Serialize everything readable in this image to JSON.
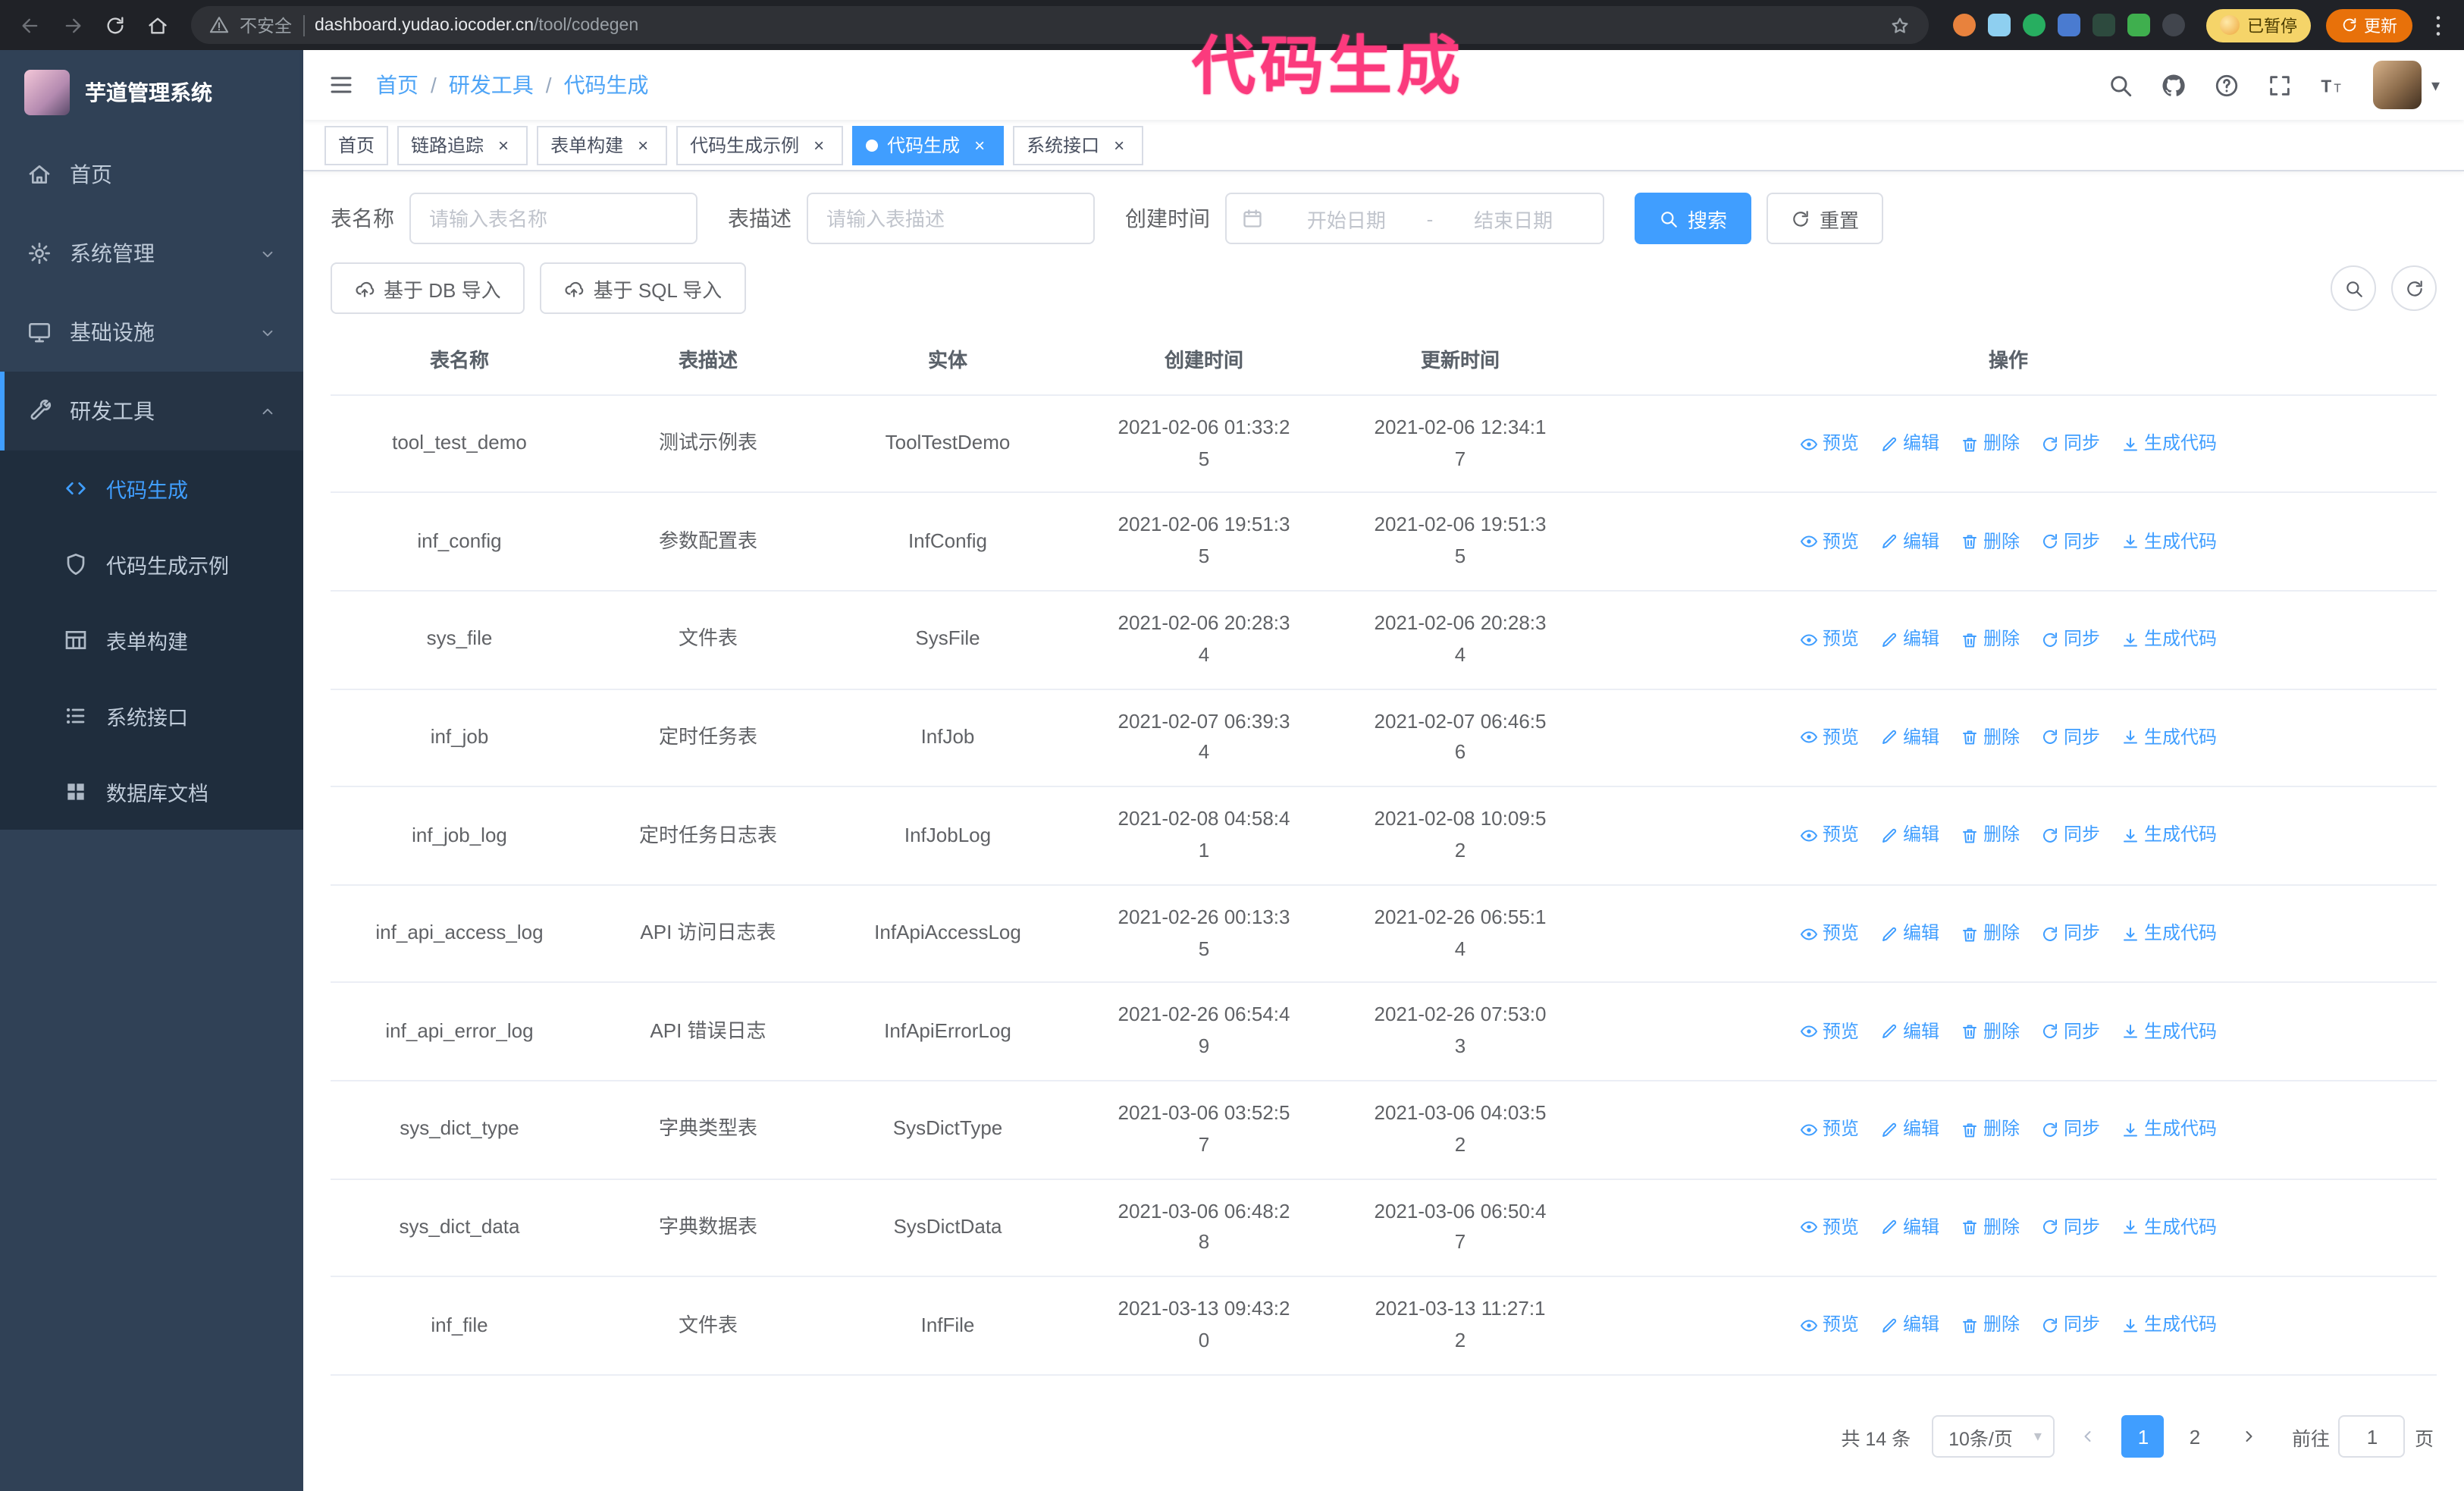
{
  "colors": {
    "primary": "#409EFF",
    "sidebar": "#304156",
    "submenu": "#1f2d3d",
    "annotation": "#fb3a7d"
  },
  "browser": {
    "address": {
      "security_label": "不安全",
      "host": "dashboard.yudao.iocoder.cn",
      "path": "/tool/codegen"
    },
    "paused_badge": "已暂停",
    "update_button": "更新",
    "extensions": [
      {
        "name": "extension-fox-icon",
        "color": "#e8823d",
        "shape": "circle"
      },
      {
        "name": "extension-drop-icon",
        "color": "#8ecff0",
        "shape": "square"
      },
      {
        "name": "extension-check-icon",
        "color": "#27ae60",
        "shape": "circle"
      },
      {
        "name": "extension-users-icon",
        "color": "#4a7bd0",
        "shape": "square"
      },
      {
        "name": "extension-chart-icon",
        "color": "#2d4a3e",
        "shape": "square"
      },
      {
        "name": "extension-leaf-icon",
        "color": "#3faf4e",
        "shape": "square"
      },
      {
        "name": "extension-pin-icon",
        "color": "#41454d",
        "shape": "circle"
      }
    ]
  },
  "annotation": {
    "text": "代码生成"
  },
  "sidebar": {
    "logo_title": "芋道管理系统",
    "items": [
      {
        "key": "home",
        "label": "首页",
        "icon": "home-icon"
      },
      {
        "key": "system",
        "label": "系统管理",
        "icon": "gear-icon",
        "chevron": "down"
      },
      {
        "key": "infra",
        "label": "基础设施",
        "icon": "monitor-icon",
        "chevron": "down"
      },
      {
        "key": "devtools",
        "label": "研发工具",
        "icon": "wrench-icon",
        "chevron": "up",
        "active": true,
        "children": [
          {
            "key": "codegen",
            "label": "代码生成",
            "icon": "code-icon",
            "active": true
          },
          {
            "key": "codegen-demo",
            "label": "代码生成示例",
            "icon": "shield-icon"
          },
          {
            "key": "form-builder",
            "label": "表单构建",
            "icon": "form-icon"
          },
          {
            "key": "system-api",
            "label": "系统接口",
            "icon": "list-icon"
          },
          {
            "key": "db-doc",
            "label": "数据库文档",
            "icon": "grid-icon"
          }
        ]
      }
    ]
  },
  "navbar": {
    "breadcrumb": [
      "首页",
      "研发工具",
      "代码生成"
    ],
    "breadcrumb_separator": "/"
  },
  "tabs": [
    {
      "key": "home",
      "label": "首页",
      "closable": false,
      "active": false
    },
    {
      "key": "tracer",
      "label": "链路追踪",
      "closable": true,
      "active": false
    },
    {
      "key": "form-builder",
      "label": "表单构建",
      "closable": true,
      "active": false
    },
    {
      "key": "codegen-demo",
      "label": "代码生成示例",
      "closable": true,
      "active": false
    },
    {
      "key": "codegen",
      "label": "代码生成",
      "closable": true,
      "active": true
    },
    {
      "key": "system-api",
      "label": "系统接口",
      "closable": true,
      "active": false
    }
  ],
  "filters": {
    "name_label": "表名称",
    "name_placeholder": "请输入表名称",
    "desc_label": "表描述",
    "desc_placeholder": "请输入表描述",
    "time_label": "创建时间",
    "start_placeholder": "开始日期",
    "range_separator": "-",
    "end_placeholder": "结束日期",
    "search_button": "搜索",
    "reset_button": "重置"
  },
  "toolbar": {
    "import_db": "基于 DB 导入",
    "import_sql": "基于 SQL 导入"
  },
  "table": {
    "columns": [
      "表名称",
      "表描述",
      "实体",
      "创建时间",
      "更新时间",
      "操作"
    ],
    "actions": [
      {
        "key": "preview",
        "label": "预览",
        "icon": "eye-icon"
      },
      {
        "key": "edit",
        "label": "编辑",
        "icon": "edit-icon"
      },
      {
        "key": "delete",
        "label": "删除",
        "icon": "delete-icon"
      },
      {
        "key": "sync",
        "label": "同步",
        "icon": "sync-icon"
      },
      {
        "key": "generate",
        "label": "生成代码",
        "icon": "download-icon"
      }
    ],
    "rows": [
      {
        "name": "tool_test_demo",
        "desc": "测试示例表",
        "entity": "ToolTestDemo",
        "created": "2021-02-06 01:33:25",
        "updated": "2021-02-06 12:34:17"
      },
      {
        "name": "inf_config",
        "desc": "参数配置表",
        "entity": "InfConfig",
        "created": "2021-02-06 19:51:35",
        "updated": "2021-02-06 19:51:35"
      },
      {
        "name": "sys_file",
        "desc": "文件表",
        "entity": "SysFile",
        "created": "2021-02-06 20:28:34",
        "updated": "2021-02-06 20:28:34"
      },
      {
        "name": "inf_job",
        "desc": "定时任务表",
        "entity": "InfJob",
        "created": "2021-02-07 06:39:34",
        "updated": "2021-02-07 06:46:56"
      },
      {
        "name": "inf_job_log",
        "desc": "定时任务日志表",
        "entity": "InfJobLog",
        "created": "2021-02-08 04:58:41",
        "updated": "2021-02-08 10:09:52"
      },
      {
        "name": "inf_api_access_log",
        "desc": "API 访问日志表",
        "entity": "InfApiAccessLog",
        "created": "2021-02-26 00:13:35",
        "updated": "2021-02-26 06:55:14"
      },
      {
        "name": "inf_api_error_log",
        "desc": "API 错误日志",
        "entity": "InfApiErrorLog",
        "created": "2021-02-26 06:54:49",
        "updated": "2021-02-26 07:53:03"
      },
      {
        "name": "sys_dict_type",
        "desc": "字典类型表",
        "entity": "SysDictType",
        "created": "2021-03-06 03:52:57",
        "updated": "2021-03-06 04:03:52"
      },
      {
        "name": "sys_dict_data",
        "desc": "字典数据表",
        "entity": "SysDictData",
        "created": "2021-03-06 06:48:28",
        "updated": "2021-03-06 06:50:47"
      },
      {
        "name": "inf_file",
        "desc": "文件表",
        "entity": "InfFile",
        "created": "2021-03-13 09:43:20",
        "updated": "2021-03-13 11:27:12"
      }
    ]
  },
  "pagination": {
    "total": "共 14 条",
    "page_size": "10条/页",
    "pages": [
      "1",
      "2"
    ],
    "active_page": "1",
    "goto_label": "前往",
    "goto_value": "1",
    "goto_suffix": "页"
  }
}
